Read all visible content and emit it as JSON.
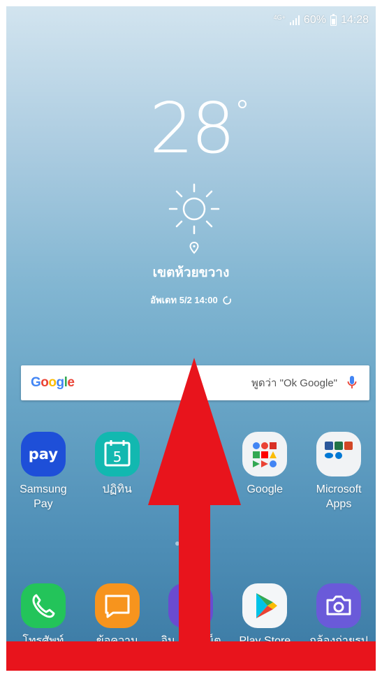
{
  "status_bar": {
    "network": "4G+",
    "battery_percent": "60%",
    "time": "14:28"
  },
  "weather": {
    "temperature": "28",
    "location": "เขตห้วยขวาง",
    "updated": "อัพเดท 5/2 14:00",
    "condition_icon": "sun-icon"
  },
  "search": {
    "logo": "Google",
    "hint": "พูดว่า \"Ok Google\""
  },
  "apps_row1": [
    {
      "label": "Samsung Pay",
      "icon": "samsung-pay-icon",
      "glyph": "pay"
    },
    {
      "label": "ปฏิทิน",
      "icon": "calendar-icon",
      "glyph": "5"
    },
    {
      "label": "",
      "icon": "hidden-app-icon"
    },
    {
      "label": "Google",
      "icon": "google-folder-icon"
    },
    {
      "label": "Microsoft Apps",
      "icon": "microsoft-folder-icon"
    }
  ],
  "dock": [
    {
      "label": "โทรศัพท์",
      "icon": "phone-icon"
    },
    {
      "label": "ข้อความ",
      "icon": "message-icon"
    },
    {
      "label": "อิน          น็ต",
      "icon": "internet-icon"
    },
    {
      "label": "Play Store",
      "icon": "play-store-icon"
    },
    {
      "label": "กล้องถ่ายรูป",
      "icon": "camera-icon"
    }
  ],
  "overlay": {
    "gesture": "swipe-up-arrow-icon",
    "color": "#e8141c"
  }
}
